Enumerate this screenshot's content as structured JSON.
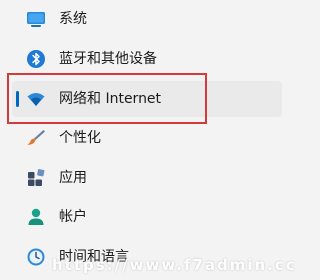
{
  "nav": {
    "items": [
      {
        "label": "系统",
        "icon": "display-icon"
      },
      {
        "label": "蓝牙和其他设备",
        "icon": "bluetooth-icon"
      },
      {
        "label": "网络和 Internet",
        "icon": "wifi-icon",
        "selected": true
      },
      {
        "label": "个性化",
        "icon": "paintbrush-icon"
      },
      {
        "label": "应用",
        "icon": "apps-icon"
      },
      {
        "label": "帐户",
        "icon": "person-icon"
      },
      {
        "label": "时间和语言",
        "icon": "clock-globe-icon"
      }
    ]
  },
  "watermark": "https://www.f7admin.cc",
  "colors": {
    "accent": "#0067c0",
    "highlight_border": "#d23b3b",
    "selected_bg": "#eaeaea",
    "page_bg": "#f3f3f3"
  }
}
